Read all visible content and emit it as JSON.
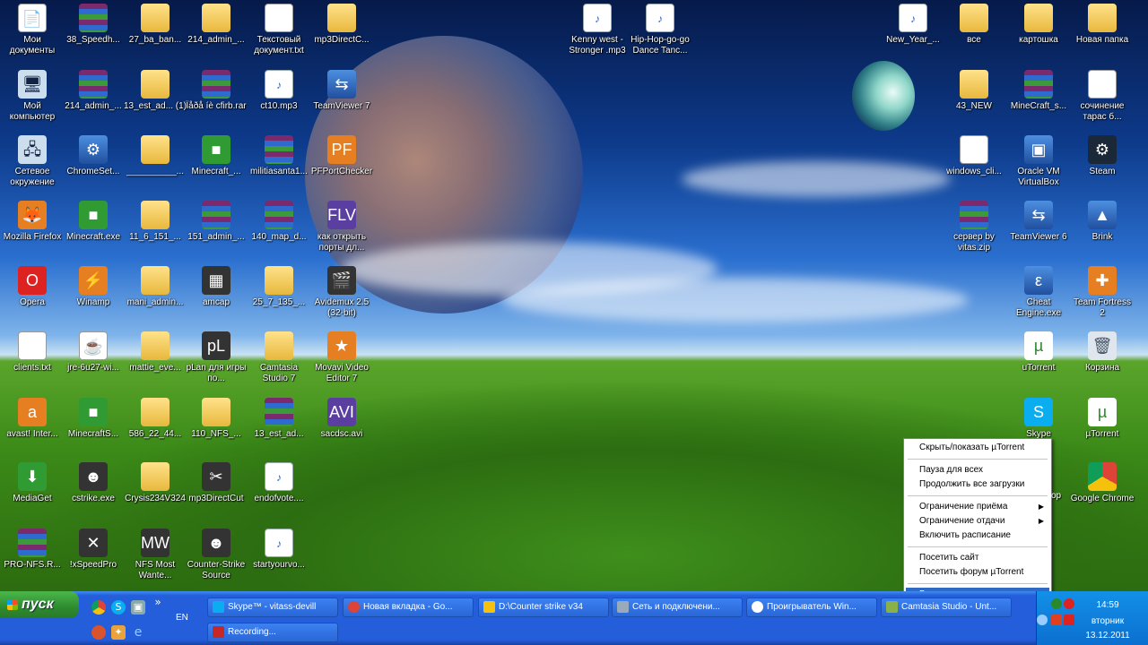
{
  "desktop": {
    "icons": [
      {
        "label": "Мои документы",
        "kind": "doc",
        "glyph": "📄"
      },
      {
        "label": "38_Speedh...",
        "kind": "rar",
        "glyph": ""
      },
      {
        "label": "27_ba_ban...",
        "kind": "folder",
        "glyph": ""
      },
      {
        "label": "214_admin_...",
        "kind": "folder",
        "glyph": ""
      },
      {
        "label": "Текстовый документ.txt",
        "kind": "doc",
        "glyph": ""
      },
      {
        "label": "mp3DirectC...",
        "kind": "folder",
        "glyph": ""
      },
      {
        "label": "Kenny west - Stronger .mp3",
        "kind": "mp3",
        "glyph": "♪"
      },
      {
        "label": "Hip-Hop-go-go Dance Tanc...",
        "kind": "mp3",
        "glyph": "♪"
      },
      {
        "label": "New_Year_...",
        "kind": "mp3",
        "glyph": "♪"
      },
      {
        "label": "все",
        "kind": "folder",
        "glyph": ""
      },
      {
        "label": "картошка",
        "kind": "folder",
        "glyph": ""
      },
      {
        "label": "Новая папка",
        "kind": "folder",
        "glyph": ""
      },
      {
        "label": "Мой компьютер",
        "kind": "pc",
        "glyph": "🖥"
      },
      {
        "label": "214_admin_...",
        "kind": "rar",
        "glyph": ""
      },
      {
        "label": "13_est_ad... (1)",
        "kind": "folder",
        "glyph": ""
      },
      {
        "label": "Ïåðå íè cfirb.rar",
        "kind": "rar",
        "glyph": ""
      },
      {
        "label": "ct10.mp3",
        "kind": "mp3",
        "glyph": "♪"
      },
      {
        "label": "TeamViewer 7",
        "kind": "app",
        "glyph": "⇆"
      },
      {
        "label": "43_NEW",
        "kind": "folder",
        "glyph": ""
      },
      {
        "label": "MineCraft_s...",
        "kind": "rar",
        "glyph": ""
      },
      {
        "label": "сочинение тарас б...",
        "kind": "doc",
        "glyph": ""
      },
      {
        "label": "Сетевое окружение",
        "kind": "pc",
        "glyph": "🖧"
      },
      {
        "label": "ChromeSet...",
        "kind": "app",
        "glyph": "⚙"
      },
      {
        "label": "__________...",
        "kind": "folder",
        "glyph": ""
      },
      {
        "label": "Minecraft_...",
        "kind": "green",
        "glyph": "■"
      },
      {
        "label": "militiasanta1...",
        "kind": "rar",
        "glyph": ""
      },
      {
        "label": "PFPortChecker",
        "kind": "orange",
        "glyph": "PF"
      },
      {
        "label": "windows_cli...",
        "kind": "doc",
        "glyph": ""
      },
      {
        "label": "Oracle VM VirtualBox",
        "kind": "app",
        "glyph": "▣"
      },
      {
        "label": "Steam",
        "kind": "steam",
        "glyph": "⚙"
      },
      {
        "label": "Mozilla Firefox",
        "kind": "orange",
        "glyph": "🦊"
      },
      {
        "label": "Minecraft.exe",
        "kind": "green",
        "glyph": "■"
      },
      {
        "label": "11_6_151_...",
        "kind": "folder",
        "glyph": ""
      },
      {
        "label": "151_admin_...",
        "kind": "rar",
        "glyph": ""
      },
      {
        "label": "140_map_d...",
        "kind": "rar",
        "glyph": ""
      },
      {
        "label": "как открыть порты дл...",
        "kind": "purple",
        "glyph": "FLV"
      },
      {
        "label": "сервер by vitas.zip",
        "kind": "rar",
        "glyph": ""
      },
      {
        "label": "TeamViewer 6",
        "kind": "app",
        "glyph": "⇆"
      },
      {
        "label": "Brink",
        "kind": "app",
        "glyph": "▲"
      },
      {
        "label": "Opera",
        "kind": "red",
        "glyph": "O"
      },
      {
        "label": "Winamp",
        "kind": "orange",
        "glyph": "⚡"
      },
      {
        "label": "mani_admin...",
        "kind": "folder",
        "glyph": ""
      },
      {
        "label": "amcap",
        "kind": "dark",
        "glyph": "▦"
      },
      {
        "label": "25_7_135_...",
        "kind": "folder",
        "glyph": ""
      },
      {
        "label": "Avidemux 2.5 (32-bit)",
        "kind": "dark",
        "glyph": "🎬"
      },
      {
        "label": "Cheat Engine.exe",
        "kind": "app",
        "glyph": "ε"
      },
      {
        "label": "Team Fortress 2",
        "kind": "orange",
        "glyph": "✚"
      },
      {
        "label": "clients.txt",
        "kind": "doc",
        "glyph": ""
      },
      {
        "label": "jre-6u27-wi...",
        "kind": "doc",
        "glyph": "☕"
      },
      {
        "label": "mattie_eve...",
        "kind": "folder",
        "glyph": ""
      },
      {
        "label": "pLan для игры по...",
        "kind": "dark",
        "glyph": "pL"
      },
      {
        "label": "Camtasia Studio 7",
        "kind": "folder",
        "glyph": ""
      },
      {
        "label": "Movavi Video Editor 7",
        "kind": "orange",
        "glyph": "★"
      },
      {
        "label": "uTorrent",
        "kind": "utorrent",
        "glyph": "µ"
      },
      {
        "label": "Корзина",
        "kind": "bin",
        "glyph": "🗑"
      },
      {
        "label": "avast! Inter...",
        "kind": "orange",
        "glyph": "a"
      },
      {
        "label": "MinecraftS...",
        "kind": "green",
        "glyph": "■"
      },
      {
        "label": "586_22_44...",
        "kind": "folder",
        "glyph": ""
      },
      {
        "label": "110_NFS_...",
        "kind": "folder",
        "glyph": ""
      },
      {
        "label": "13_est_ad...",
        "kind": "rar",
        "glyph": ""
      },
      {
        "label": "sacdsc.avi",
        "kind": "purple",
        "glyph": "AVI"
      },
      {
        "label": "Skype",
        "kind": "skype",
        "glyph": "S"
      },
      {
        "label": "µTorrent",
        "kind": "utorrent",
        "glyph": "µ"
      },
      {
        "label": "MediaGet",
        "kind": "green",
        "glyph": "⬇"
      },
      {
        "label": "cstrike.exe",
        "kind": "dark",
        "glyph": "☻"
      },
      {
        "label": "Crysis234V324",
        "kind": "folder",
        "glyph": ""
      },
      {
        "label": "mp3DirectCut",
        "kind": "dark",
        "glyph": "✂"
      },
      {
        "label": "endofvote....",
        "kind": "mp3",
        "glyph": "♪"
      },
      {
        "label": "Google Chrome",
        "kind": "chrome",
        "glyph": ""
      },
      {
        "label": "PRO-NFS.R...",
        "kind": "rar",
        "glyph": ""
      },
      {
        "label": "!xSpeedPro",
        "kind": "dark",
        "glyph": "✕"
      },
      {
        "label": "NFS Most Wante...",
        "kind": "dark",
        "glyph": "MW"
      },
      {
        "label": "Counter-Strike Source",
        "kind": "dark",
        "glyph": "☻"
      },
      {
        "label": "startyourvo...",
        "kind": "mp3",
        "glyph": "♪"
      }
    ]
  },
  "context_menu": {
    "items": [
      {
        "label": "Скрыть/показать µTorrent",
        "submenu": false
      },
      {
        "label": "Пауза для всех",
        "submenu": false
      },
      {
        "label": "Продолжить все загрузки",
        "submenu": false
      },
      {
        "label": "Ограничение приёма",
        "submenu": true
      },
      {
        "label": "Ограничение отдачи",
        "submenu": true
      },
      {
        "label": "Включить расписание",
        "submenu": false
      },
      {
        "label": "Посетить сайт",
        "submenu": false
      },
      {
        "label": "Посетить форум µTorrent",
        "submenu": false
      },
      {
        "label": "Выход",
        "submenu": false
      }
    ],
    "partial_label_behind": "op"
  },
  "taskbar": {
    "start_label": "пуск",
    "lang": "EN",
    "expand_glyph": "»",
    "buttons_row1": [
      {
        "label": "Skype™ - vitass-devill",
        "color": "#0aaef0"
      },
      {
        "label": "Новая вкладка - Go...",
        "color": "#db4437"
      },
      {
        "label": "D:\\Counter strike v34",
        "color": "#f4c20d"
      },
      {
        "label": "Сеть и подключени...",
        "color": "#9ab"
      },
      {
        "label": "Проигрыватель Win...",
        "color": "#2b5797"
      },
      {
        "label": "Camtasia Studio - Unt...",
        "color": "#8ab04a"
      }
    ],
    "buttons_row2": [
      {
        "label": "Recording...",
        "color": "#c62828"
      }
    ],
    "clock": {
      "time": "14:59",
      "day": "вторник",
      "date": "13.12.2011"
    }
  }
}
